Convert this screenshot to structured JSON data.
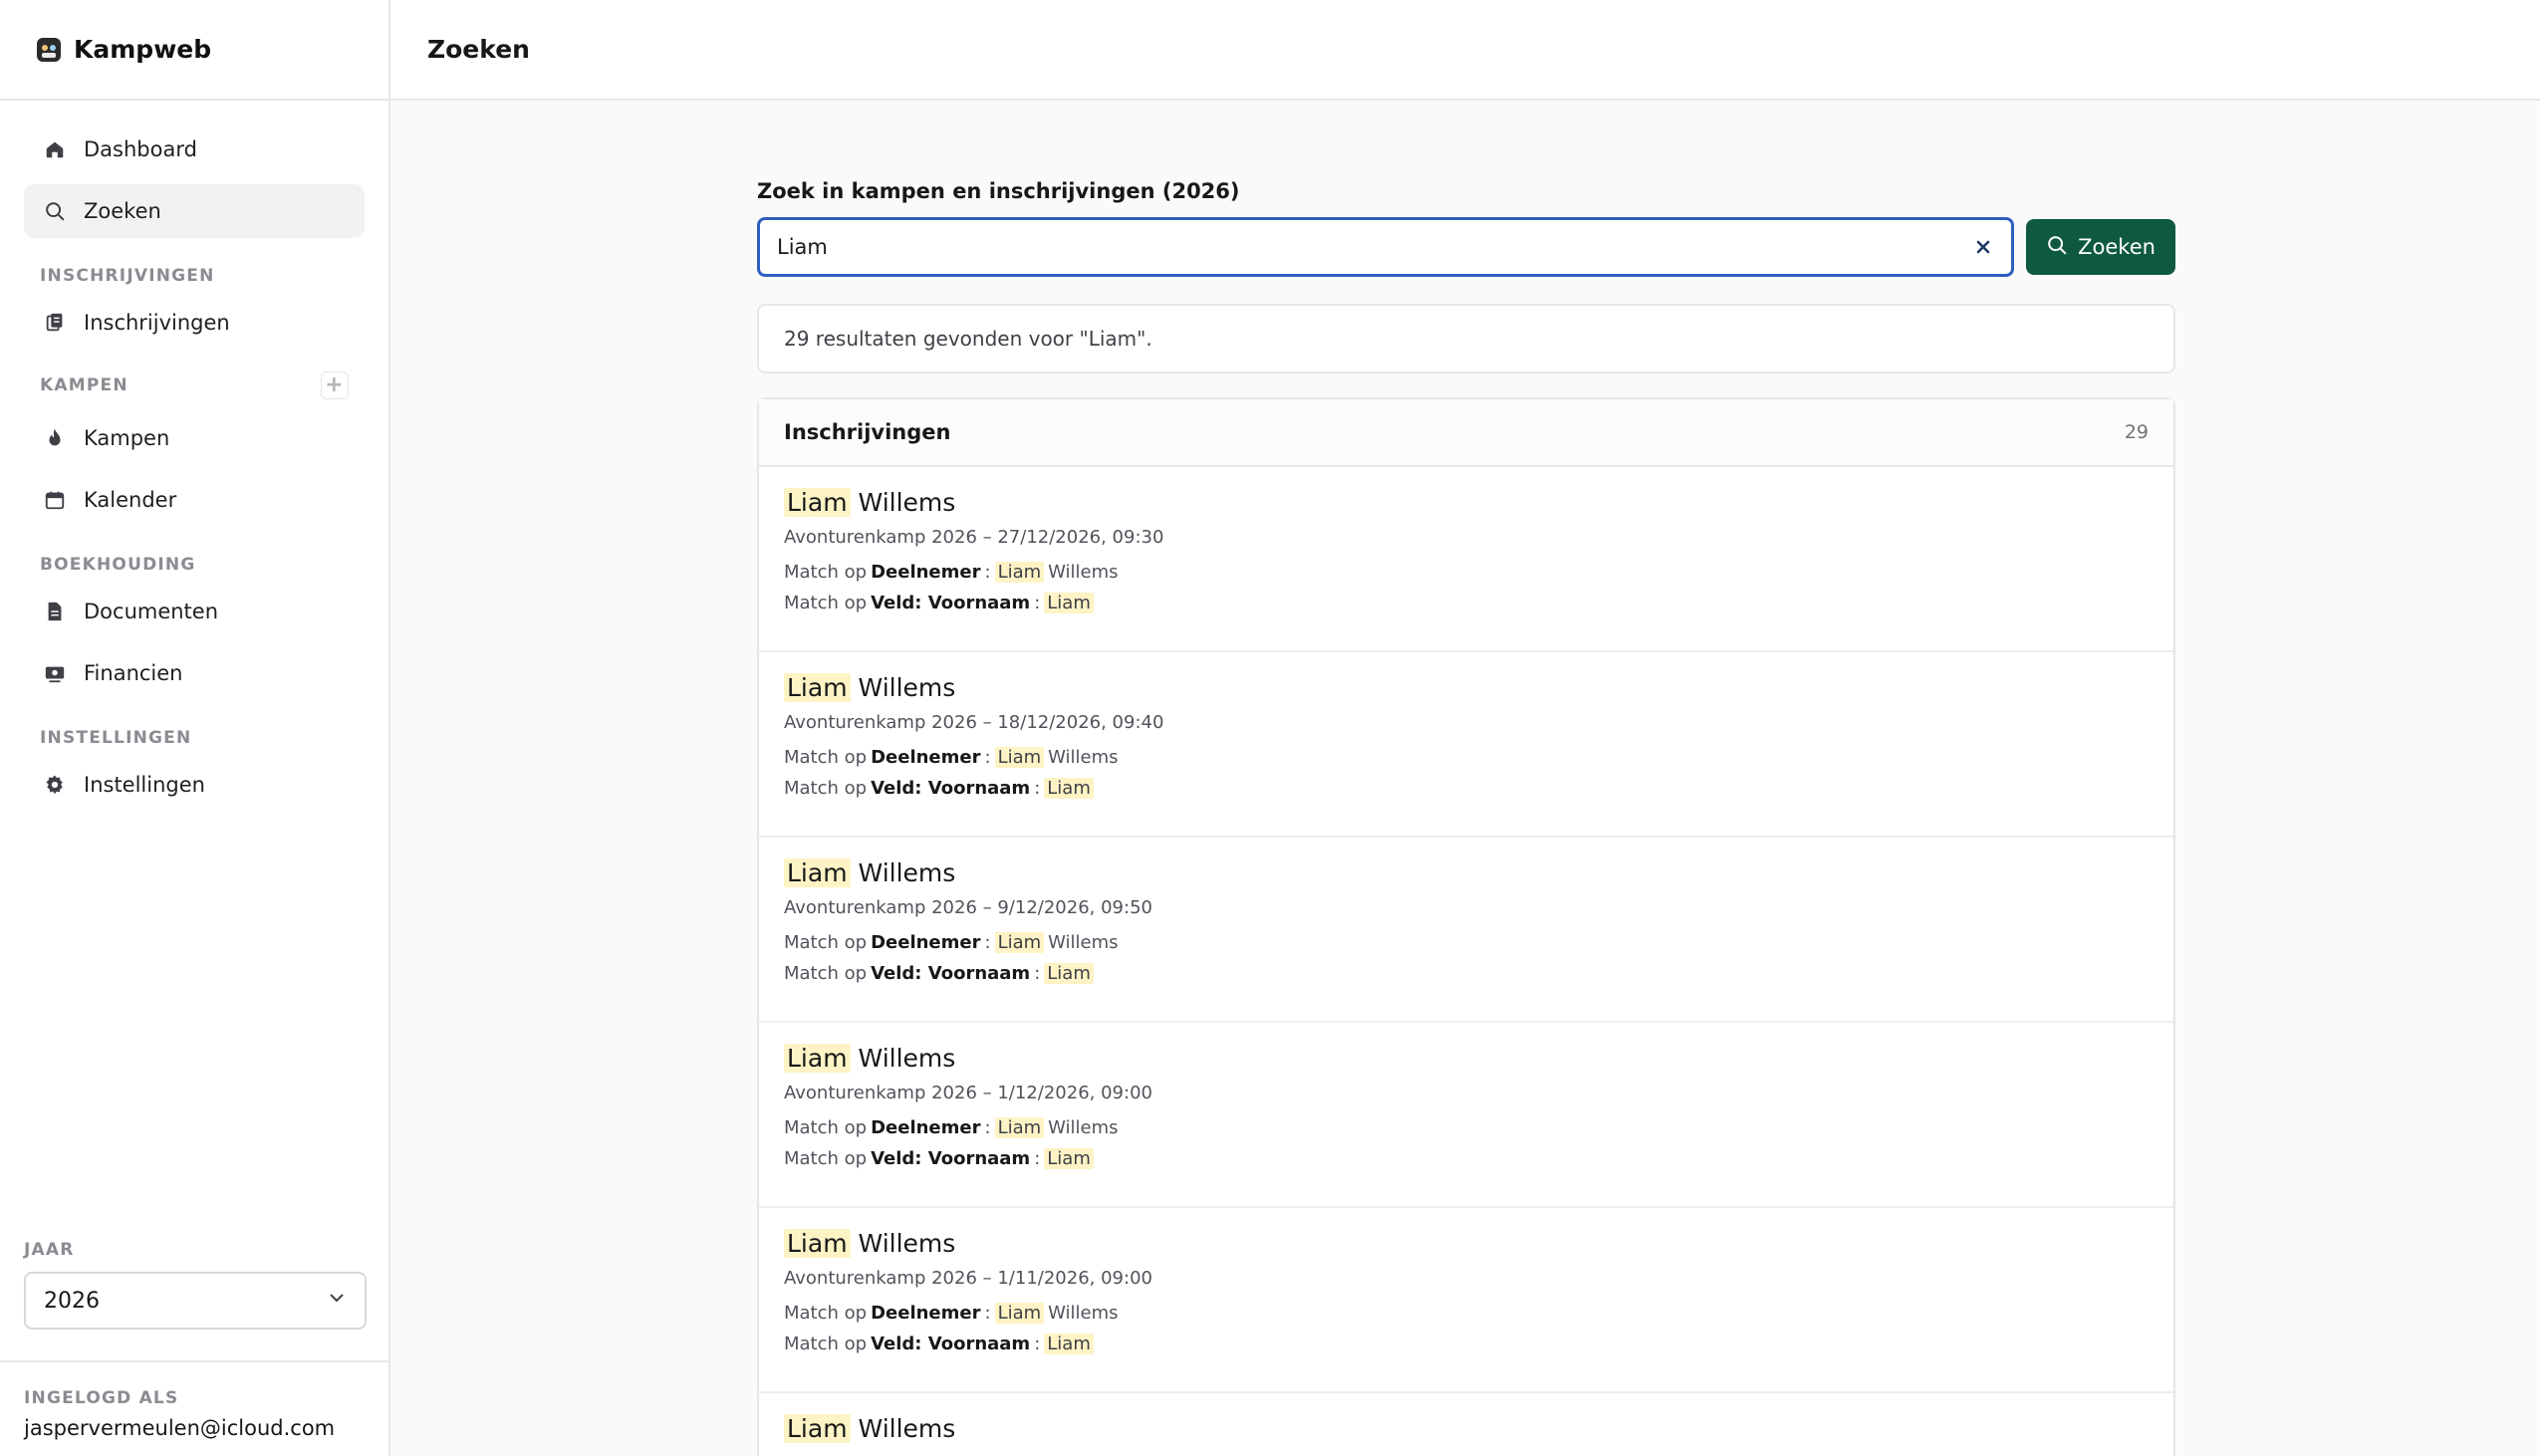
{
  "app": {
    "name": "Kampweb"
  },
  "header": {
    "title": "Zoeken"
  },
  "sidebar": {
    "items": [
      {
        "label": "Dashboard"
      },
      {
        "label": "Zoeken"
      }
    ],
    "sections": {
      "inschrijvingen": {
        "title": "INSCHRIJVINGEN",
        "items": [
          {
            "label": "Inschrijvingen"
          }
        ]
      },
      "kampen": {
        "title": "KAMPEN",
        "add_icon": "+",
        "items": [
          {
            "label": "Kampen"
          },
          {
            "label": "Kalender"
          }
        ]
      },
      "boekhouding": {
        "title": "BOEKHOUDING",
        "items": [
          {
            "label": "Documenten"
          },
          {
            "label": "Financien"
          }
        ]
      },
      "instellingen": {
        "title": "INSTELLINGEN",
        "items": [
          {
            "label": "Instellingen"
          }
        ]
      }
    },
    "year": {
      "label": "JAAR",
      "value": "2026"
    },
    "user": {
      "label": "INGELOGD ALS",
      "email": "jaspervermeulen@icloud.com"
    }
  },
  "search": {
    "label": "Zoek in kampen en inschrijvingen (2026)",
    "value": "Liam",
    "button": "Zoeken",
    "summary": "29 resultaten gevonden voor \"Liam\"."
  },
  "results": {
    "title": "Inschrijvingen",
    "count": "29",
    "match_prefix": "Match op",
    "match_participant": "Deelnemer",
    "match_field": "Veld: Voornaam",
    "items": [
      {
        "first": "Liam",
        "last": "Willems",
        "meta": "Avonturenkamp 2026 – 27/12/2026, 09:30"
      },
      {
        "first": "Liam",
        "last": "Willems",
        "meta": "Avonturenkamp 2026 – 18/12/2026, 09:40"
      },
      {
        "first": "Liam",
        "last": "Willems",
        "meta": "Avonturenkamp 2026 – 9/12/2026, 09:50"
      },
      {
        "first": "Liam",
        "last": "Willems",
        "meta": "Avonturenkamp 2026 – 1/12/2026, 09:00"
      },
      {
        "first": "Liam",
        "last": "Willems",
        "meta": "Avonturenkamp 2026 – 1/11/2026, 09:00"
      },
      {
        "first": "Liam",
        "last": "Willems",
        "meta": ""
      }
    ]
  },
  "colors": {
    "primary": "#0f5a3e",
    "focus": "#2f5fbf",
    "highlight": "#fdf3c4"
  }
}
